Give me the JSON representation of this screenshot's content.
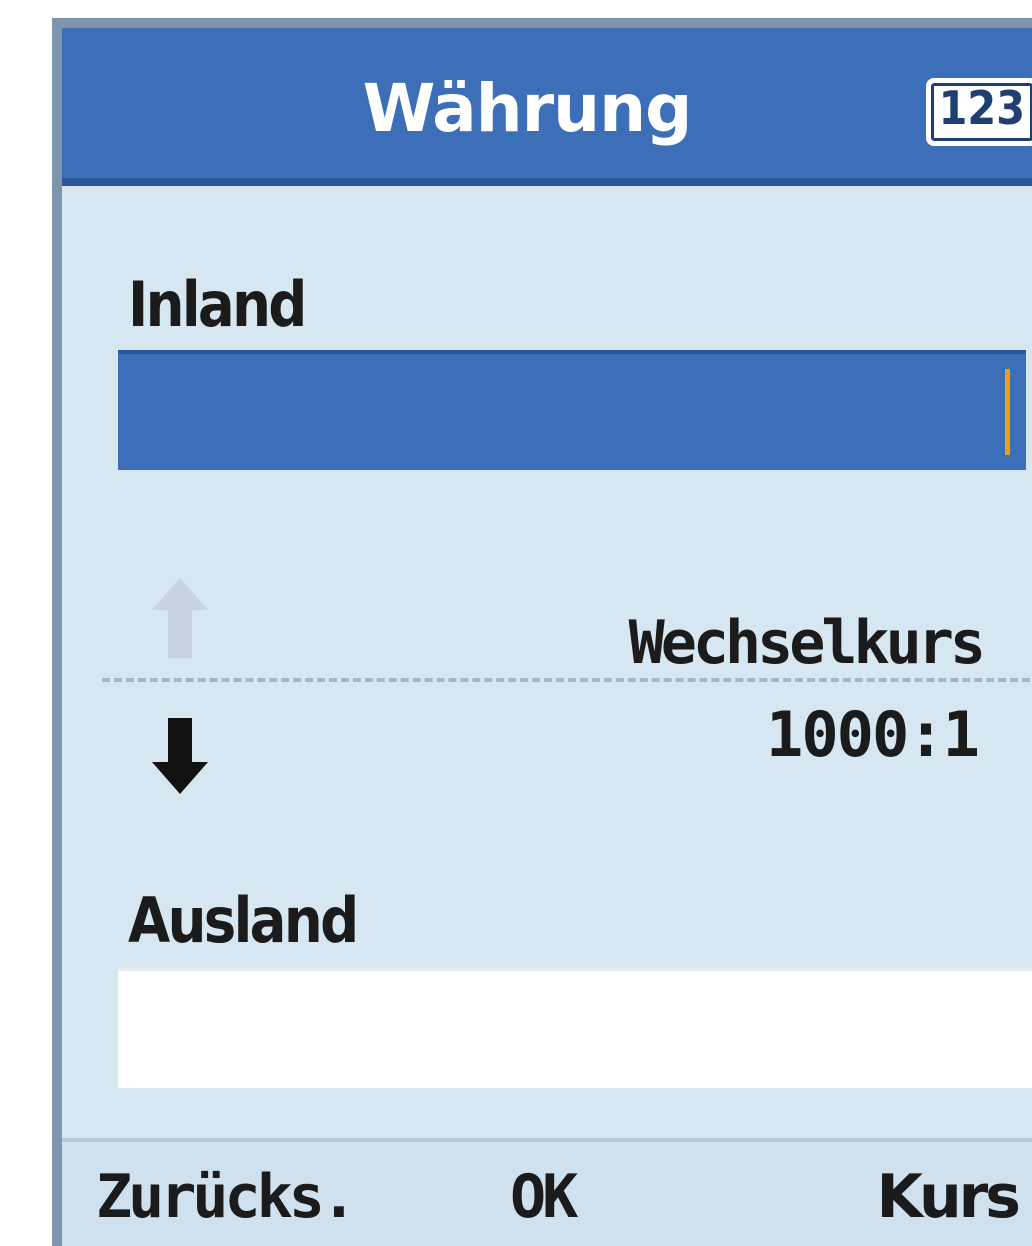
{
  "title": "Währung",
  "input_mode": "123",
  "fields": {
    "inland": {
      "label": "Inland",
      "value": ""
    },
    "ausland": {
      "label": "Ausland",
      "value": ""
    }
  },
  "exchange": {
    "label": "Wechselkurs",
    "value": "1000:1"
  },
  "softkeys": {
    "left": "Zurücks.",
    "center": "OK",
    "right": "Kurs"
  },
  "icons": {
    "up": "arrow-up-icon",
    "down": "arrow-down-icon"
  },
  "colors": {
    "titlebar": "#3d6fb8",
    "background": "#d7e7f2",
    "cursor": "#e8a21a"
  }
}
